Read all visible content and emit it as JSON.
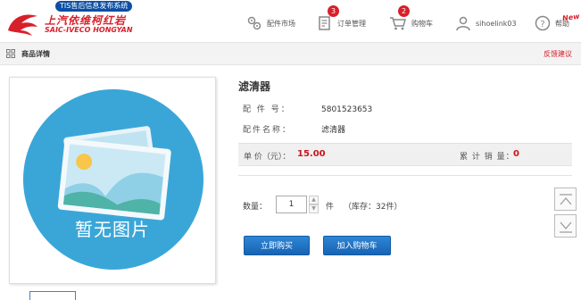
{
  "brand": {
    "tagline": "TIS售后信息发布系统",
    "name_cn": "上汽依维柯红岩",
    "name_en": "SAIC-IVECO HONGYAN",
    "color": "#d8202a"
  },
  "nav": {
    "parts_market": {
      "label": "配件市场",
      "icon": "gears-icon"
    },
    "order_manage": {
      "label": "订单管理",
      "icon": "order-icon",
      "badge": "3"
    },
    "cart": {
      "label": "购物车",
      "icon": "cart-icon",
      "badge": "2"
    },
    "user": {
      "label": "sihoelink03",
      "icon": "user-icon"
    },
    "help": {
      "label": "帮助",
      "icon": "help-icon"
    },
    "new_flag": "New"
  },
  "subbar": {
    "title": "商品详情",
    "feedback": "反馈建议"
  },
  "image_panel": {
    "placeholder_text": "暂无图片",
    "circle_color": "#3aa6d8"
  },
  "product": {
    "name": "滤清器",
    "part_no_label": "配 件 号：",
    "part_no": "5801523653",
    "part_name_label": "配件名称：",
    "part_name": "滤清器",
    "price_label": "单 价（元）：",
    "price": "15.00",
    "sales_label": "累 计 销 量：",
    "sales": "0"
  },
  "purchase": {
    "qty_label": "数量：",
    "qty_value": "1",
    "unit": "件",
    "stock": "（库存：32件）",
    "buy_now": "立即购买",
    "add_to_cart": "加入购物车"
  },
  "colors": {
    "accent_red": "#c8161d",
    "button_blue": "#1f6fc2"
  }
}
